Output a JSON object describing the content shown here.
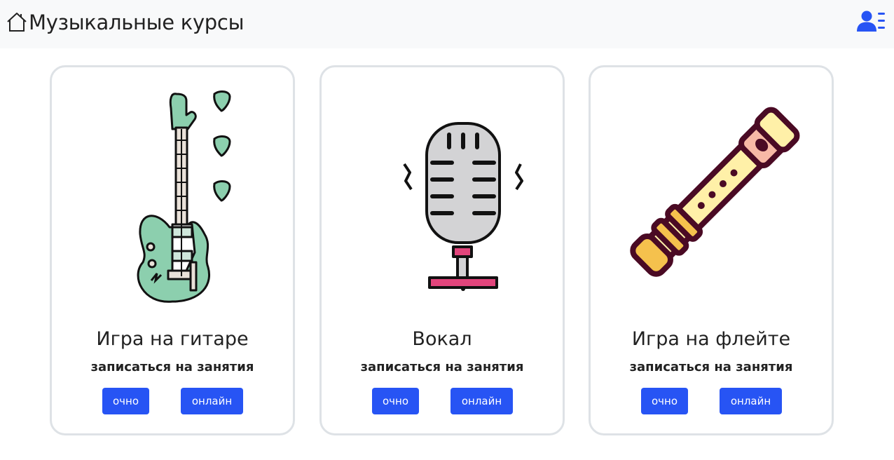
{
  "header": {
    "brand_title": "Музыкальные курсы",
    "home_icon": "house-icon",
    "user_icon": "user-list-icon",
    "accent_color": "#2754f4"
  },
  "courses": [
    {
      "title": "Игра на гитаре",
      "subtitle": "записаться на занятия",
      "btn_offline": "очно",
      "btn_online": "онлайн",
      "image": "electric-guitar-illustration"
    },
    {
      "title": "Вокал",
      "subtitle": "записаться на занятия",
      "btn_offline": "очно",
      "btn_online": "онлайн",
      "image": "microphone-illustration"
    },
    {
      "title": "Игра на флейте",
      "subtitle": "записаться на занятия",
      "btn_offline": "очно",
      "btn_online": "онлайн",
      "image": "flute-illustration"
    }
  ]
}
